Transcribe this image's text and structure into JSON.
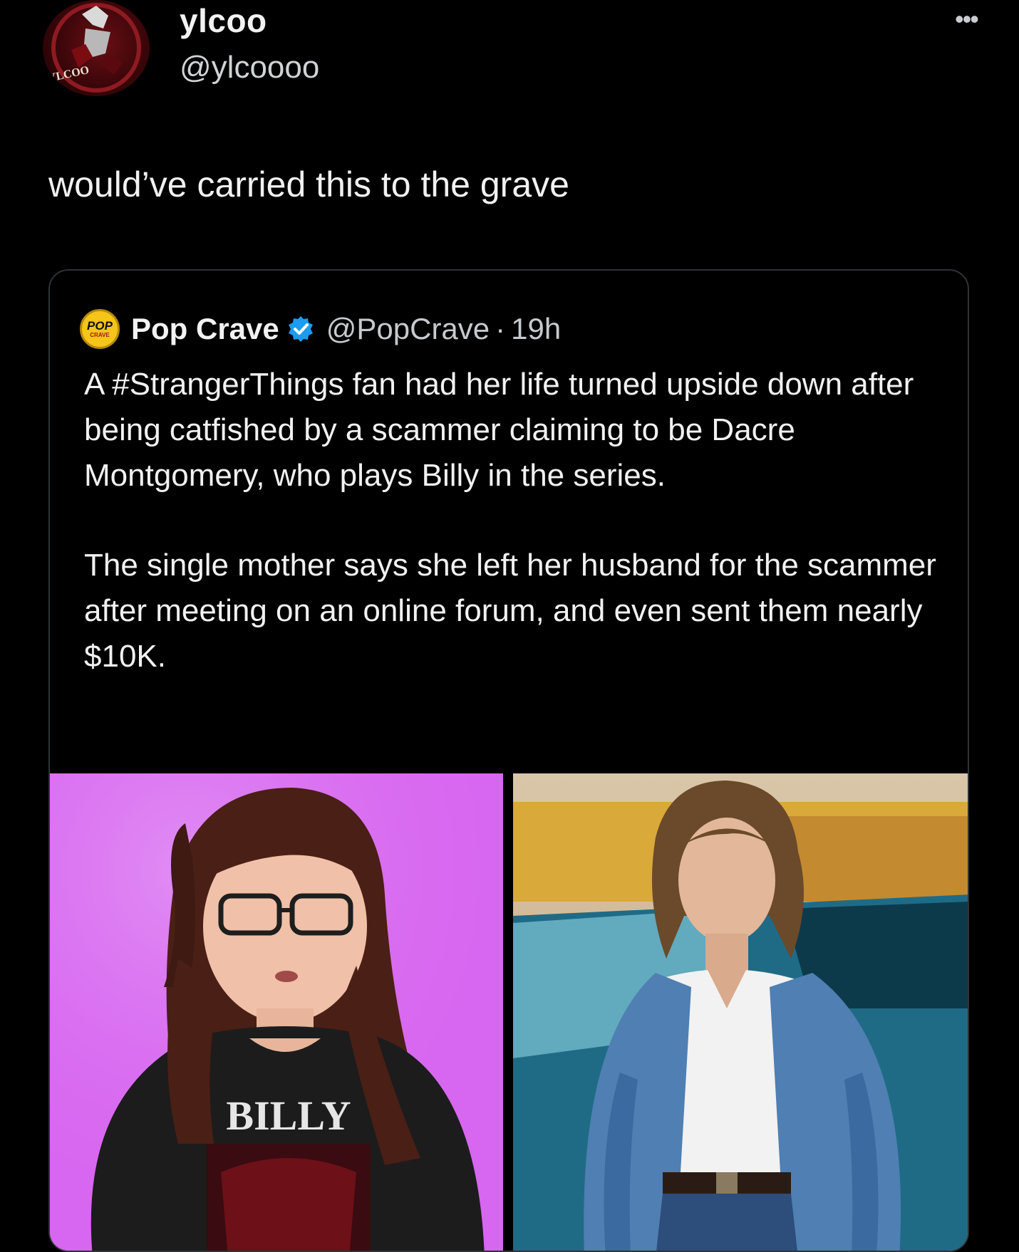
{
  "author": {
    "display_name": "ylcoo",
    "handle": "@ylcoooo",
    "avatar_text": "YLCOO"
  },
  "post": {
    "text": "would’ve carried this to the grave",
    "more_icon": "more-options-icon"
  },
  "quote": {
    "logo_text_main": "POP",
    "logo_text_sub": "CRAVE",
    "name": "Pop Crave",
    "handle": "@PopCrave",
    "separator": "·",
    "time": "19h",
    "paragraphs": [
      "A #StrangerThings fan had her life turned upside down after being catfished by a scammer claiming to be Dacre Montgomery, who plays Billy in the series.",
      "The single mother says she left her husband for the scammer after meeting on an online forum, and even sent them nearly $10K."
    ],
    "shirt_text": "BILLY"
  },
  "colors": {
    "background": "#000000",
    "verified_blue": "#1d9bf0",
    "left_photo_bg": "#d766f0"
  }
}
